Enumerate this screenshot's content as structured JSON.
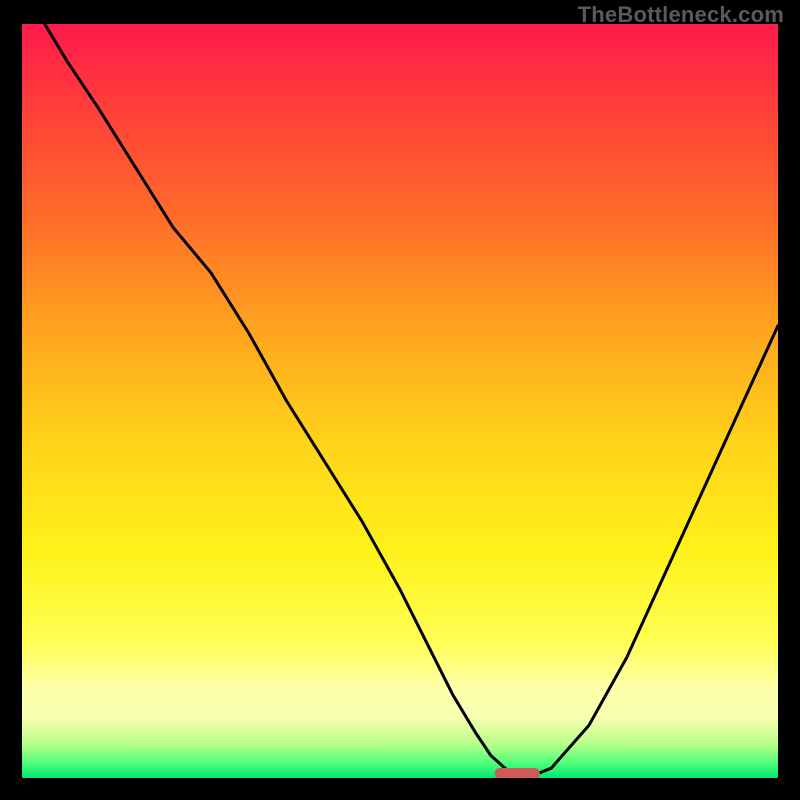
{
  "watermark": "TheBottleneck.com",
  "colors": {
    "frame": "#000000",
    "curve": "#000000",
    "marker": "#cf5a5a",
    "gradient_stops": [
      {
        "offset": 0.0,
        "color": "#ff1a4b"
      },
      {
        "offset": 0.1,
        "color": "#ff3b3b"
      },
      {
        "offset": 0.25,
        "color": "#ff6a2a"
      },
      {
        "offset": 0.4,
        "color": "#ffa21f"
      },
      {
        "offset": 0.55,
        "color": "#ffd21a"
      },
      {
        "offset": 0.7,
        "color": "#fff21a"
      },
      {
        "offset": 0.82,
        "color": "#ffff55"
      },
      {
        "offset": 0.88,
        "color": "#ffffaa"
      },
      {
        "offset": 0.92,
        "color": "#f6ffb0"
      },
      {
        "offset": 0.955,
        "color": "#b8ff8a"
      },
      {
        "offset": 0.98,
        "color": "#4fff7a"
      },
      {
        "offset": 1.0,
        "color": "#00e874"
      }
    ]
  },
  "chart_data": {
    "type": "line",
    "title": "",
    "xlabel": "",
    "ylabel": "",
    "xlim": [
      0,
      100
    ],
    "ylim": [
      0,
      100
    ],
    "grid": false,
    "legend": false,
    "series": [
      {
        "name": "bottleneck-curve",
        "x": [
          3,
          6,
          10,
          15,
          20,
          25,
          30,
          35,
          40,
          45,
          50,
          54,
          57,
          60,
          62,
          64,
          66,
          68,
          70,
          75,
          80,
          85,
          90,
          95,
          100
        ],
        "y": [
          100,
          95,
          89,
          81,
          73,
          67,
          59,
          50,
          42,
          34,
          25,
          17,
          11,
          6,
          3,
          1.2,
          0.5,
          0.5,
          1.3,
          7,
          16,
          27,
          38,
          49,
          60
        ]
      }
    ],
    "marker": {
      "name": "optimal-range",
      "x_start": 62.5,
      "x_end": 68.5,
      "y": 0.6
    }
  }
}
